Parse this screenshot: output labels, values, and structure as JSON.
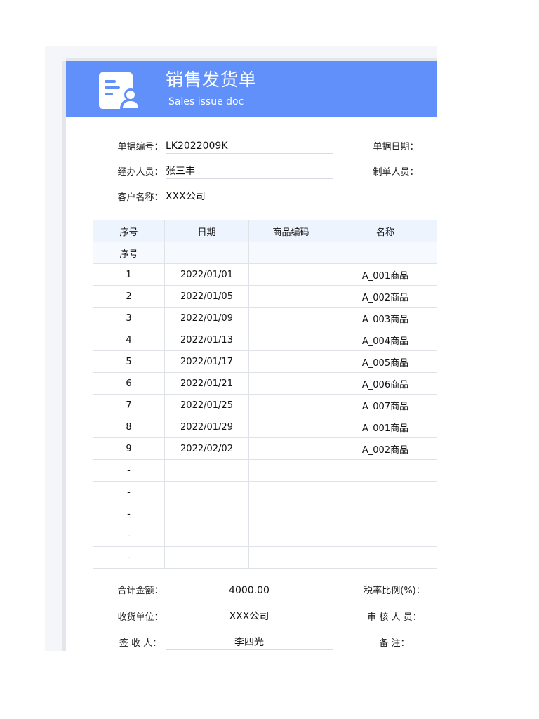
{
  "header": {
    "title": "销售发货单",
    "subtitle": "Sales issue doc"
  },
  "info": {
    "order_no_label": "单据编号：",
    "order_no": "LK2022009K",
    "right_label_1": "单据日期：",
    "handler_label": "经办人员：",
    "handler": "张三丰",
    "right_label_2": "制单人员：",
    "customer_label": "客户名称：",
    "customer": "XXX公司"
  },
  "table": {
    "columns": [
      "序号",
      "日期",
      "商品编码",
      "名称"
    ],
    "subheader": [
      "序号",
      "",
      "",
      ""
    ],
    "rows": [
      [
        "1",
        "2022/01/01",
        "",
        "A_001商品"
      ],
      [
        "2",
        "2022/01/05",
        "",
        "A_002商品"
      ],
      [
        "3",
        "2022/01/09",
        "",
        "A_003商品"
      ],
      [
        "4",
        "2022/01/13",
        "",
        "A_004商品"
      ],
      [
        "5",
        "2022/01/17",
        "",
        "A_005商品"
      ],
      [
        "6",
        "2022/01/21",
        "",
        "A_006商品"
      ],
      [
        "7",
        "2022/01/25",
        "",
        "A_007商品"
      ],
      [
        "8",
        "2022/01/29",
        "",
        "A_001商品"
      ],
      [
        "9",
        "2022/02/02",
        "",
        "A_002商品"
      ],
      [
        "-",
        "",
        "",
        ""
      ],
      [
        "-",
        "",
        "",
        ""
      ],
      [
        "-",
        "",
        "",
        ""
      ],
      [
        "-",
        "",
        "",
        ""
      ],
      [
        "-",
        "",
        "",
        ""
      ]
    ]
  },
  "footer": {
    "total_label": "合计金额：",
    "total": "4000.00",
    "tax_label": "税率比例(%)：",
    "supplier_label": "收货单位：",
    "supplier": "XXX公司",
    "right_label_2": "审 核  人 员：",
    "signer_label": "签  收  人：",
    "signer": "李四光",
    "right_label_3": "备    注："
  },
  "colors": {
    "banner": "#6290fb",
    "header_row": "#eef4fe"
  }
}
